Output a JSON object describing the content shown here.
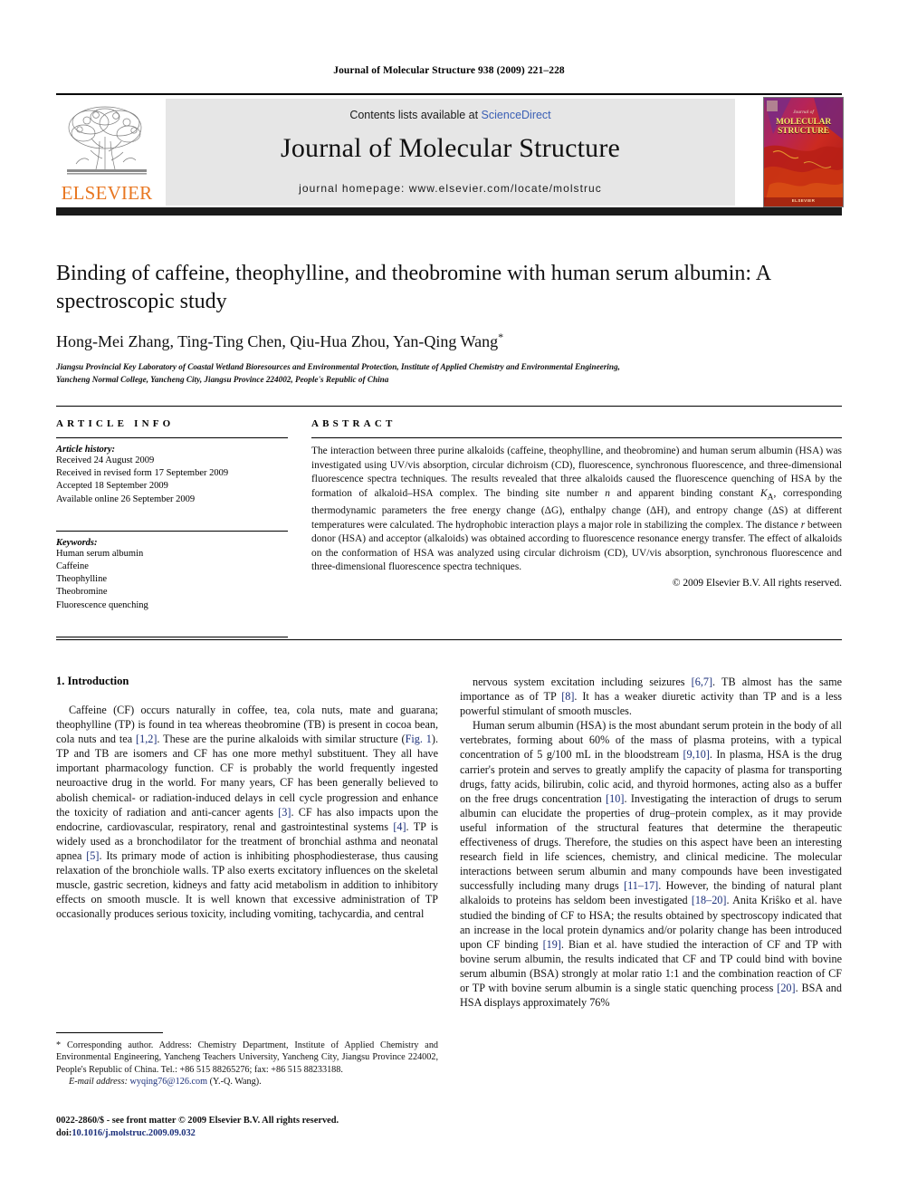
{
  "running_head": "Journal of Molecular Structure 938 (2009) 221–228",
  "masthead": {
    "contents_prefix": "Contents lists available at ",
    "sciencedirect": "ScienceDirect",
    "journal_title": "Journal of Molecular Structure",
    "homepage": "journal homepage: www.elsevier.com/locate/molstruc",
    "publisher_name": "ELSEVIER",
    "cover": {
      "superline": "Journal of",
      "line1": "MOLECULAR",
      "line2": "STRUCTURE",
      "footer": "ELSEVIER"
    },
    "link_color": "#3a5fb5",
    "panel_color": "#e6e6e6",
    "brand_orange": "#E87722"
  },
  "article": {
    "title": "Binding of caffeine, theophylline, and theobromine with human serum albumin: A spectroscopic study",
    "authors": "Hong-Mei Zhang, Ting-Ting Chen, Qiu-Hua Zhou, Yan-Qing Wang",
    "corresponding_marker": "*",
    "affiliation_line1": "Jiangsu Provincial Key Laboratory of Coastal Wetland Bioresources and Environmental Protection, Institute of Applied Chemistry and Environmental Engineering,",
    "affiliation_line2": "Yancheng Normal College, Yancheng City, Jiangsu Province 224002, People's Republic of China"
  },
  "info": {
    "heading": "ARTICLE INFO",
    "history_label": "Article history:",
    "history": [
      "Received 24 August 2009",
      "Received in revised form 17 September 2009",
      "Accepted 18 September 2009",
      "Available online 26 September 2009"
    ],
    "keywords_label": "Keywords:",
    "keywords": [
      "Human serum albumin",
      "Caffeine",
      "Theophylline",
      "Theobromine",
      "Fluorescence quenching"
    ]
  },
  "abstract": {
    "heading": "ABSTRACT",
    "text": "The interaction between three purine alkaloids (caffeine, theophylline, and theobromine) and human serum albumin (HSA) was investigated using UV/vis absorption, circular dichroism (CD), fluorescence, synchronous fluorescence, and three-dimensional fluorescence spectra techniques. The results revealed that three alkaloids caused the fluorescence quenching of HSA by the formation of alkaloid–HSA complex. The binding site number n and apparent binding constant KA, corresponding thermodynamic parameters the free energy change (ΔG), enthalpy change (ΔH), and entropy change (ΔS) at different temperatures were calculated. The hydrophobic interaction plays a major role in stabilizing the complex. The distance r between donor (HSA) and acceptor (alkaloids) was obtained according to fluorescence resonance energy transfer. The effect of alkaloids on the conformation of HSA was analyzed using circular dichroism (CD), UV/vis absorption, synchronous fluorescence and three-dimensional fluorescence spectra techniques.",
    "copyright": "© 2009 Elsevier B.V. All rights reserved."
  },
  "body": {
    "section_heading": "1. Introduction",
    "left_paragraphs": [
      "Caffeine (CF) occurs naturally in coffee, tea, cola nuts, mate and guarana; theophylline (TP) is found in tea whereas theobromine (TB) is present in cocoa bean, cola nuts and tea [1,2]. These are the purine alkaloids with similar structure (Fig. 1). TP and TB are isomers and CF has one more methyl substituent. They all have important pharmacology function. CF is probably the world frequently ingested neuroactive drug in the world. For many years, CF has been generally believed to abolish chemical- or radiation-induced delays in cell cycle progression and enhance the toxicity of radiation and anti-cancer agents [3]. CF has also impacts upon the endocrine, cardiovascular, respiratory, renal and gastrointestinal systems [4]. TP is widely used as a bronchodilator for the treatment of bronchial asthma and neonatal apnea [5]. Its primary mode of action is inhibiting phosphodiesterase, thus causing relaxation of the bronchiole walls. TP also exerts excitatory influences on the skeletal muscle, gastric secretion, kidneys and fatty acid metabolism in addition to inhibitory effects on smooth muscle. It is well known that excessive administration of TP occasionally produces serious toxicity, including vomiting, tachycardia, and central"
    ],
    "right_paragraphs": [
      "nervous system excitation including seizures [6,7]. TB almost has the same importance as of TP [8]. It has a weaker diuretic activity than TP and is a less powerful stimulant of smooth muscles.",
      "Human serum albumin (HSA) is the most abundant serum protein in the body of all vertebrates, forming about 60% of the mass of plasma proteins, with a typical concentration of 5 g/100 mL in the bloodstream [9,10]. In plasma, HSA is the drug carrier's protein and serves to greatly amplify the capacity of plasma for transporting drugs, fatty acids, bilirubin, colic acid, and thyroid hormones, acting also as a buffer on the free drugs concentration [10]. Investigating the interaction of drugs to serum albumin can elucidate the properties of drug–protein complex, as it may provide useful information of the structural features that determine the therapeutic effectiveness of drugs. Therefore, the studies on this aspect have been an interesting research field in life sciences, chemistry, and clinical medicine. The molecular interactions between serum albumin and many compounds have been investigated successfully including many drugs [11–17]. However, the binding of natural plant alkaloids to proteins has seldom been investigated [18–20]. Anita Kriŝko et al. have studied the binding of CF to HSA; the results obtained by spectroscopy indicated that an increase in the local protein dynamics and/or polarity change has been introduced upon CF binding [19]. Bian et al. have studied the interaction of CF and TP with bovine serum albumin, the results indicated that CF and TP could bind with bovine serum albumin (BSA) strongly at molar ratio 1:1 and the combination reaction of CF or TP with bovine serum albumin is a single static quenching process [20]. BSA and HSA displays approximately 76%"
    ]
  },
  "footnote": {
    "marker": "*",
    "text": "Corresponding author. Address: Chemistry Department, Institute of Applied Chemistry and Environmental Engineering, Yancheng Teachers University, Yancheng City, Jiangsu Province 224002, People's Republic of China. Tel.: +86 515 88265276; fax: +86 515 88233188.",
    "email_label": "E-mail address:",
    "email": "wyqing76@126.com",
    "email_suffix": "(Y.-Q. Wang)."
  },
  "imprint": {
    "line1": "0022-2860/$ - see front matter © 2009 Elsevier B.V. All rights reserved.",
    "doi_label": "doi:",
    "doi": "10.1016/j.molstruc.2009.09.032"
  }
}
